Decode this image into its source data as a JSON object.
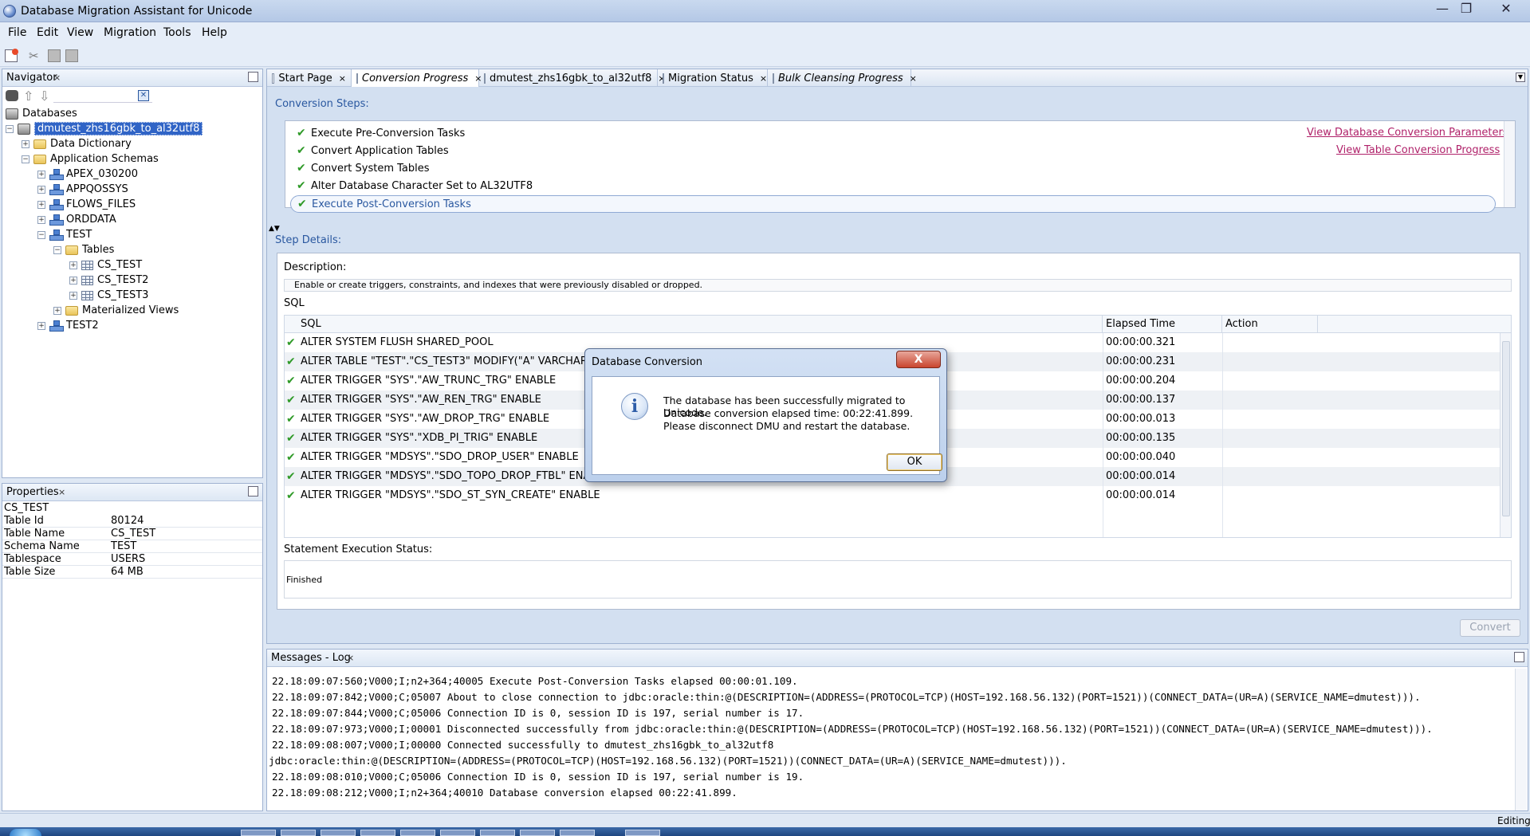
{
  "window": {
    "title": "Database Migration Assistant for Unicode",
    "minimize": "—",
    "maximize": "❐",
    "close": "✕"
  },
  "menu": {
    "items": [
      "File",
      "Edit",
      "View",
      "Migration",
      "Tools",
      "Help"
    ]
  },
  "navigator": {
    "title": "Navigator",
    "root": "Databases",
    "db": "dmutest_zhs16gbk_to_al32utf8",
    "nodes": {
      "data_dictionary": "Data Dictionary",
      "app_schemas": "Application Schemas",
      "apex": "APEX_030200",
      "appqossys": "APPQOSSYS",
      "flows_files": "FLOWS_FILES",
      "orddata": "ORDDATA",
      "test": "TEST",
      "tables": "Tables",
      "cs_test": "CS_TEST",
      "cs_test2": "CS_TEST2",
      "cs_test3": "CS_TEST3",
      "mviews": "Materialized Views",
      "test2": "TEST2"
    }
  },
  "properties": {
    "title": "Properties",
    "object": "CS_TEST",
    "rows": [
      {
        "key": "Table Id",
        "value": "80124"
      },
      {
        "key": "Table Name",
        "value": "CS_TEST"
      },
      {
        "key": "Schema Name",
        "value": "TEST"
      },
      {
        "key": "Tablespace",
        "value": "USERS"
      },
      {
        "key": "Table Size",
        "value": "64 MB"
      }
    ]
  },
  "tabs": [
    {
      "label": "Start Page"
    },
    {
      "label": "Conversion Progress"
    },
    {
      "label": "dmutest_zhs16gbk_to_al32utf8"
    },
    {
      "label": "Migration Status"
    },
    {
      "label": "Bulk Cleansing Progress"
    }
  ],
  "conversion": {
    "steps_title": "Conversion Steps:",
    "steps": [
      "Execute Pre-Conversion Tasks",
      "Convert Application Tables",
      "Convert System Tables",
      "Alter Database Character Set to AL32UTF8",
      "Execute Post-Conversion Tasks"
    ],
    "link_params": "View Database Conversion Parameters",
    "link_progress": "View Table Conversion Progress",
    "details_title": "Step Details:",
    "description_label": "Description:",
    "description": "Enable or create triggers, constraints, and indexes that were previously disabled or dropped.",
    "sql_label": "SQL",
    "columns": {
      "sql": "SQL",
      "elapsed": "Elapsed Time",
      "action": "Action"
    },
    "sql_rows": [
      {
        "sql": "ALTER SYSTEM FLUSH SHARED_POOL",
        "elapsed": "00:00:00.321"
      },
      {
        "sql": "ALTER TABLE \"TEST\".\"CS_TEST3\" MODIFY(\"A\" VARCHAR2(4",
        "elapsed": "00:00:00.231"
      },
      {
        "sql": "ALTER TRIGGER \"SYS\".\"AW_TRUNC_TRG\" ENABLE",
        "elapsed": "00:00:00.204"
      },
      {
        "sql": "ALTER TRIGGER \"SYS\".\"AW_REN_TRG\" ENABLE",
        "elapsed": "00:00:00.137"
      },
      {
        "sql": "ALTER TRIGGER \"SYS\".\"AW_DROP_TRG\" ENABLE",
        "elapsed": "00:00:00.013"
      },
      {
        "sql": "ALTER TRIGGER \"SYS\".\"XDB_PI_TRIG\" ENABLE",
        "elapsed": "00:00:00.135"
      },
      {
        "sql": "ALTER TRIGGER \"MDSYS\".\"SDO_DROP_USER\" ENABLE",
        "elapsed": "00:00:00.040"
      },
      {
        "sql": "ALTER TRIGGER \"MDSYS\".\"SDO_TOPO_DROP_FTBL\" ENABLE",
        "elapsed": "00:00:00.014"
      },
      {
        "sql": "ALTER TRIGGER \"MDSYS\".\"SDO_ST_SYN_CREATE\" ENABLE",
        "elapsed": "00:00:00.014"
      }
    ],
    "status_label": "Statement Execution Status:",
    "status_value": "Finished",
    "convert_button": "Convert"
  },
  "dialog": {
    "title": "Database Conversion",
    "close": "X",
    "line1": "The database has been successfully migrated to Unicode.",
    "line2": "Database conversion elapsed time: 00:22:41.899.",
    "line3": "Please disconnect DMU and restart the database.",
    "ok": "OK"
  },
  "messages": {
    "title": "Messages - Log",
    "lines": [
      "22.18:09:07:560;V000;I;n2+364;40005 Execute Post-Conversion Tasks elapsed 00:00:01.109.",
      "22.18:09:07:842;V000;C;05007 About to close connection to jdbc:oracle:thin:@(DESCRIPTION=(ADDRESS=(PROTOCOL=TCP)(HOST=192.168.56.132)(PORT=1521))(CONNECT_DATA=(UR=A)(SERVICE_NAME=dmutest))).",
      "22.18:09:07:844;V000;C;05006 Connection ID is 0, session ID is 197, serial number is 17.",
      "22.18:09:07:973;V000;I;00001 Disconnected successfully from jdbc:oracle:thin:@(DESCRIPTION=(ADDRESS=(PROTOCOL=TCP)(HOST=192.168.56.132)(PORT=1521))(CONNECT_DATA=(UR=A)(SERVICE_NAME=dmutest))).",
      "22.18:09:08:007;V000;I;00000 Connected successfully to dmutest_zhs16gbk_to_al32utf8",
      "jdbc:oracle:thin:@(DESCRIPTION=(ADDRESS=(PROTOCOL=TCP)(HOST=192.168.56.132)(PORT=1521))(CONNECT_DATA=(UR=A)(SERVICE_NAME=dmutest))).",
      "22.18:09:08:010;V000;C;05006 Connection ID is 0, session ID is 197, serial number is 19.",
      "22.18:09:08:212;V000;I;n2+364;40010 Database conversion elapsed 00:22:41.899."
    ]
  },
  "status_bar": {
    "text": "Editing"
  }
}
